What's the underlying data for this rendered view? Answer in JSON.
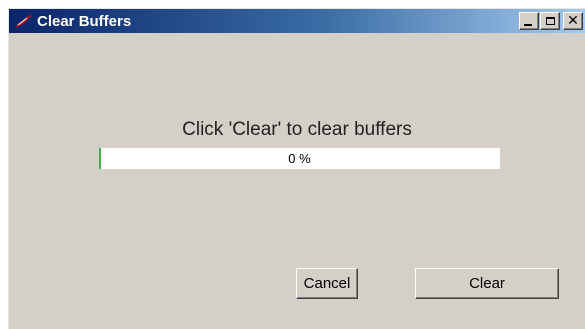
{
  "window": {
    "title": "Clear Buffers",
    "controls": {
      "minimize_icon": "minimize-icon",
      "maximize_icon": "maximize-icon",
      "close_icon": "close-icon"
    }
  },
  "dialog": {
    "prompt": "Click 'Clear' to clear buffers",
    "progress": {
      "value": 0,
      "text": "0 %"
    }
  },
  "buttons": {
    "cancel_label": "Cancel",
    "clear_label": "Clear"
  },
  "colors": {
    "titlebar_start": "#0a246a",
    "titlebar_end": "#a6caf0",
    "window_bg": "#d4d0c8",
    "progress_fill": "#3fb24a"
  }
}
